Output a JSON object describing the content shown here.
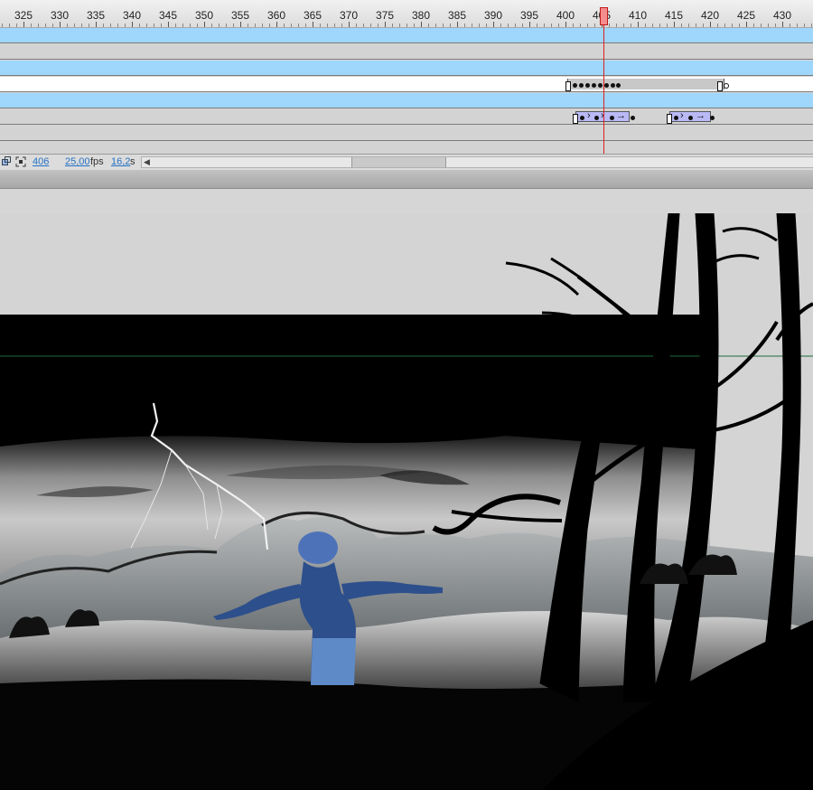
{
  "timeline": {
    "ruler_labels": [
      "325",
      "330",
      "335",
      "340",
      "345",
      "350",
      "355",
      "360",
      "365",
      "370",
      "375",
      "380",
      "385",
      "390",
      "395",
      "400",
      "405",
      "410",
      "415",
      "420",
      "425",
      "430"
    ],
    "current_frame_label": "405",
    "status": {
      "frame": "406",
      "fps_value": "25,00",
      "fps_unit": "fps",
      "time_value": "16,2",
      "time_unit": "s"
    }
  },
  "colors": {
    "layer_blue": "#9fd6fb",
    "playhead": "#e02020",
    "tween_span": "#b9b9f5",
    "link_blue": "#2572c4"
  },
  "icons": [
    "onion-skin-icon",
    "edit-multiple-frames-icon",
    "scroll-left-arrow-icon"
  ]
}
